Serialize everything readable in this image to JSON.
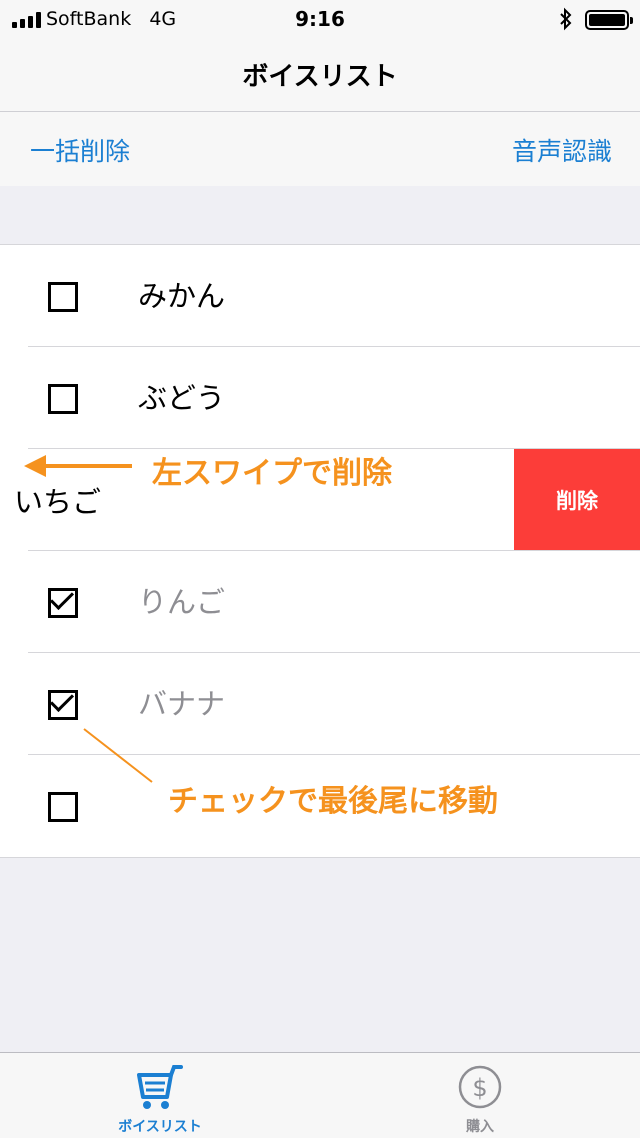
{
  "status_bar": {
    "carrier": "SoftBank",
    "network": "4G",
    "time": "9:16"
  },
  "nav": {
    "title": "ボイスリスト"
  },
  "toolbar": {
    "bulk_delete_label": "一括削除",
    "voice_recognition_label": "音声認識"
  },
  "items": [
    {
      "label": "みかん",
      "checked": false
    },
    {
      "label": "ぶどう",
      "checked": false
    },
    {
      "label": "いちご",
      "checked": false,
      "swiped": true,
      "delete_label": "削除"
    },
    {
      "label": "りんご",
      "checked": true
    },
    {
      "label": "バナナ",
      "checked": true
    },
    {
      "label": "",
      "checked": false
    }
  ],
  "annotations": {
    "swipe": "左スワイプで削除",
    "check": "チェックで最後尾に移動"
  },
  "tabbar": {
    "list_label": "ボイスリスト",
    "buy_label": "購入",
    "active_color": "#1b7fd2",
    "inactive_color": "#8e8e93"
  },
  "colors": {
    "accent": "#1b7fd2",
    "delete": "#fc3d39",
    "annotation": "#f5921e"
  }
}
